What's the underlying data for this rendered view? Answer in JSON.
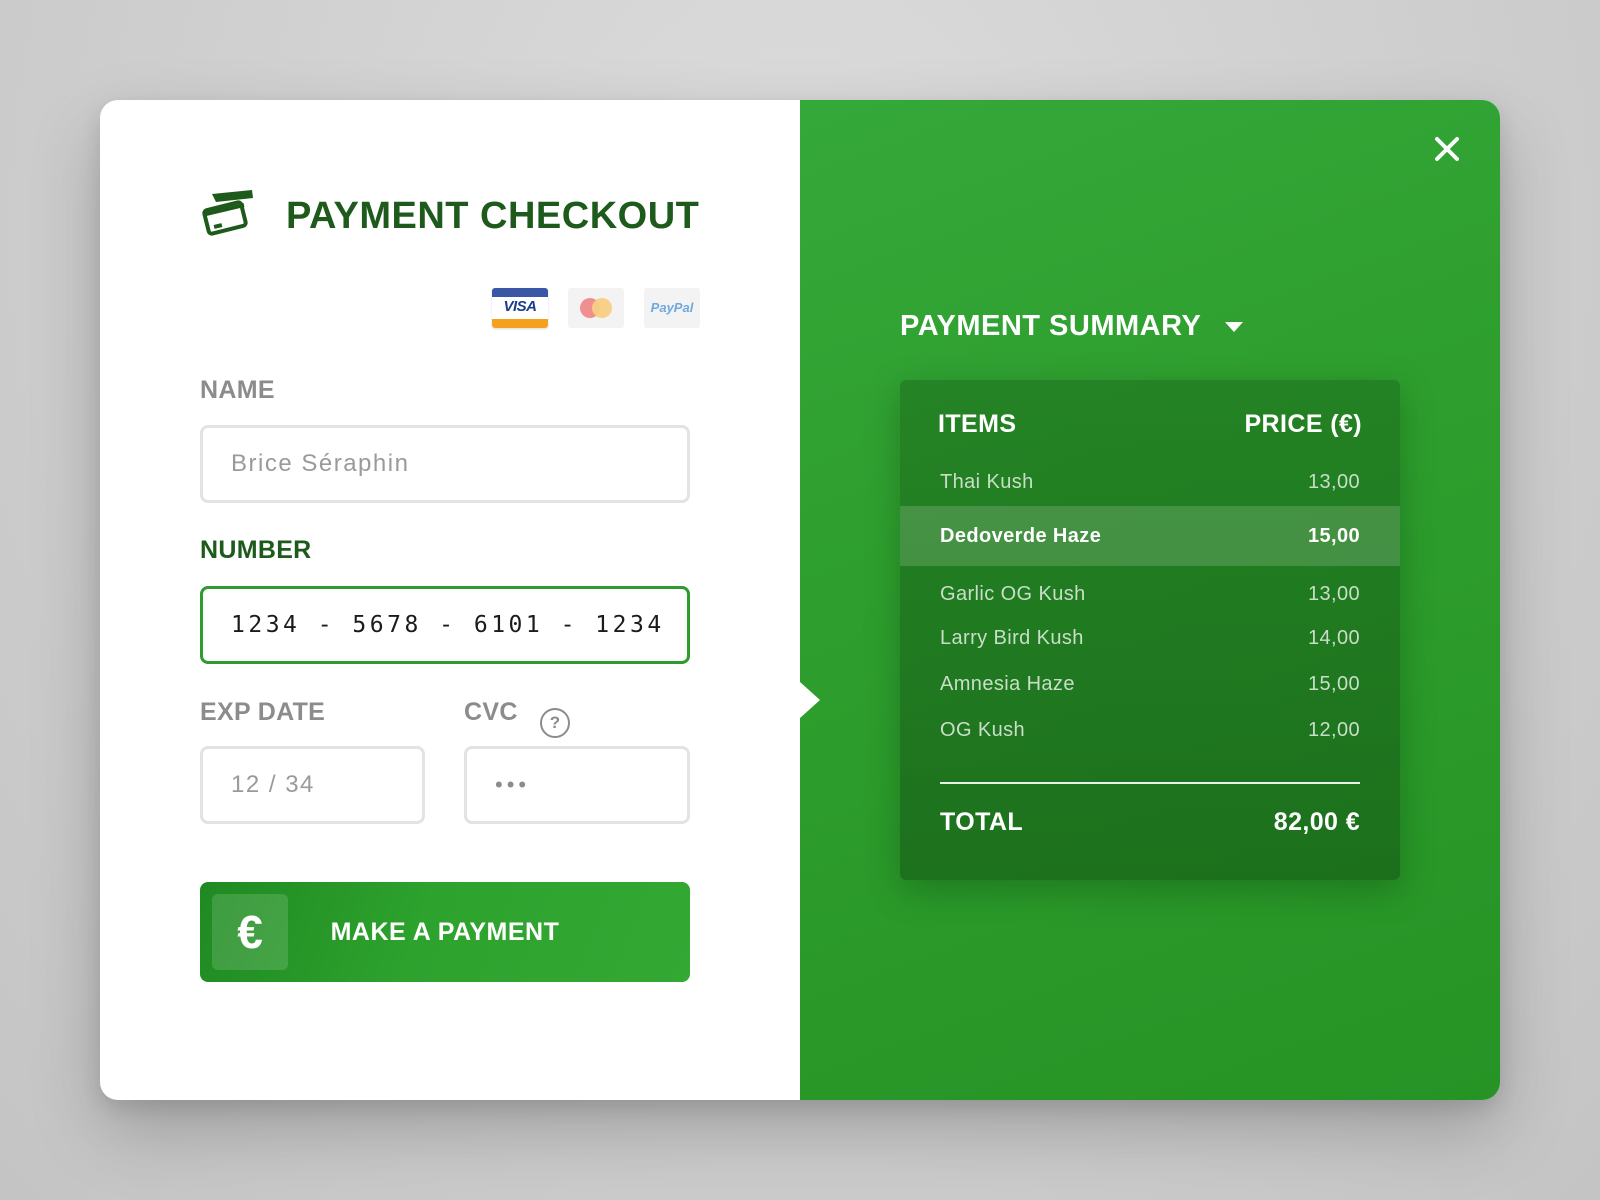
{
  "checkout": {
    "title": "PAYMENT CHECKOUT",
    "brand_icon": "credit-cards-icon",
    "payment_methods": [
      {
        "name": "visa",
        "label": "VISA"
      },
      {
        "name": "mastercard",
        "label": ""
      },
      {
        "name": "paypal",
        "label": "PayPal"
      }
    ],
    "fields": {
      "name": {
        "label": "NAME",
        "value": "Brice Séraphin"
      },
      "number": {
        "label": "NUMBER",
        "value": "1234 - 5678 - 6101 - 1234"
      },
      "exp_date": {
        "label": "EXP DATE",
        "placeholder": "12 / 34"
      },
      "cvc": {
        "label": "CVC",
        "value": "•••",
        "help": "?"
      }
    },
    "pay_button": {
      "icon": "€",
      "label": "MAKE A PAYMENT"
    }
  },
  "summary": {
    "title": "PAYMENT SUMMARY",
    "columns": {
      "items": "ITEMS",
      "price": "PRICE (€)"
    },
    "rows": [
      {
        "item": "Thai Kush",
        "price": "13,00"
      },
      {
        "item": "Dedoverde Haze",
        "price": "15,00"
      },
      {
        "item": "Garlic OG Kush",
        "price": "13,00"
      },
      {
        "item": "Larry Bird Kush",
        "price": "14,00"
      },
      {
        "item": "Amnesia Haze",
        "price": "15,00"
      },
      {
        "item": "OG Kush",
        "price": "12,00"
      }
    ],
    "selected_row_index": 1,
    "total": {
      "label": "TOTAL",
      "value": "82,00 €"
    }
  },
  "colors": {
    "brand_dark_green": "#1e5a1c",
    "accent_green": "#2e9f2e",
    "border_gray": "#e3e3e3",
    "label_gray": "#8c8c8c"
  }
}
